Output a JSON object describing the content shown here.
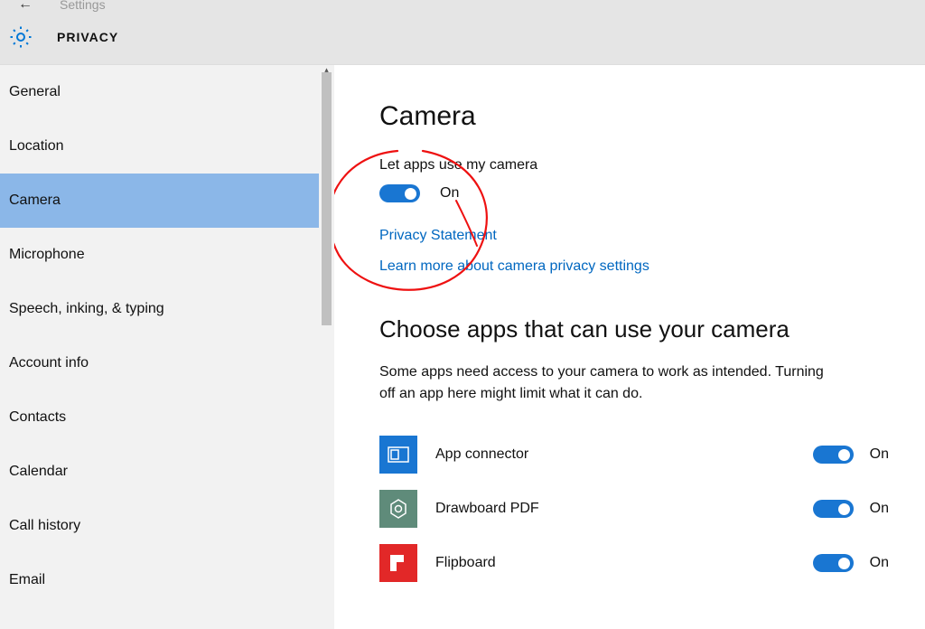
{
  "window": {
    "app": "Settings",
    "header": "PRIVACY"
  },
  "sidebar": {
    "items": [
      {
        "label": "General"
      },
      {
        "label": "Location"
      },
      {
        "label": "Camera"
      },
      {
        "label": "Microphone"
      },
      {
        "label": "Speech, inking, & typing"
      },
      {
        "label": "Account info"
      },
      {
        "label": "Contacts"
      },
      {
        "label": "Calendar"
      },
      {
        "label": "Call history"
      },
      {
        "label": "Email"
      }
    ],
    "selected_index": 2
  },
  "main": {
    "title": "Camera",
    "master_toggle": {
      "label": "Let apps use my camera",
      "value_text": "On",
      "on": true
    },
    "links": {
      "privacy_statement": "Privacy Statement",
      "learn_more": "Learn more about camera privacy settings"
    },
    "apps_section": {
      "title": "Choose apps that can use your camera",
      "description": "Some apps need access to your camera to work as intended. Turning off an app here might limit what it can do.",
      "apps": [
        {
          "name": "App connector",
          "on": true,
          "value_text": "On",
          "icon_bg": "#1976d2"
        },
        {
          "name": "Drawboard PDF",
          "on": true,
          "value_text": "On",
          "icon_bg": "#5f8b7a"
        },
        {
          "name": "Flipboard",
          "on": true,
          "value_text": "On",
          "icon_bg": "#e22828"
        }
      ]
    }
  }
}
